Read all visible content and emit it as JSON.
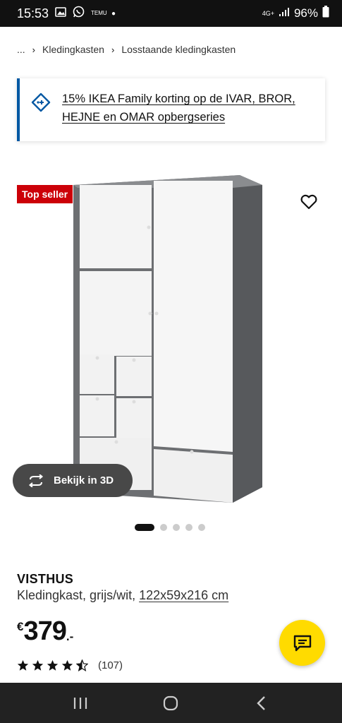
{
  "status_bar": {
    "time": "15:53",
    "temu_label": "TEMU",
    "network": "4G+",
    "battery": "96%"
  },
  "breadcrumb": {
    "more": "...",
    "items": [
      "Kledingkasten",
      "Losstaande kledingkasten"
    ]
  },
  "promo": {
    "text": "15% IKEA Family korting op de IVAR, BROR, HEJNE en OMAR opbergseries"
  },
  "gallery": {
    "badge": "Top seller",
    "view_3d_label": "Bekijk in 3D",
    "total_images": 5,
    "active_index": 0
  },
  "product": {
    "name": "VISTHUS",
    "description": "Kledingkast, grijs/wit,",
    "size": "122x59x216 cm",
    "price_currency": "€",
    "price_integer": "379",
    "price_decimal": ".-",
    "rating_value": 4.5,
    "rating_count": "(107)"
  },
  "colors": {
    "ikea_blue": "#0058a3",
    "badge_red": "#cc0008",
    "chat_yellow": "#ffdb00"
  },
  "icons": {
    "promo": "family-tag-icon",
    "favorite": "heart-icon",
    "view3d": "rotate-3d-icon",
    "chat": "chat-icon",
    "nav": [
      "recent-apps-icon",
      "home-icon",
      "back-icon"
    ]
  }
}
